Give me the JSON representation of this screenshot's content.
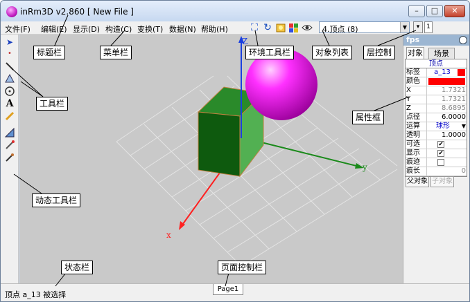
{
  "window": {
    "title": "inRm3D v2.860 [ New File ]",
    "buttons": [
      "–",
      "□",
      "✕"
    ]
  },
  "menubar": {
    "items": [
      "文件(F)",
      "编辑(E)",
      "显示(D)",
      "构造(C)",
      "变换(T)",
      "数据(N)",
      "帮助(H)"
    ]
  },
  "object_list": {
    "selected": "4.顶点 (8)"
  },
  "layer_control": {
    "value": "1"
  },
  "panel": {
    "fps": "fps",
    "tabs": [
      "对象",
      "场景"
    ],
    "header": "顶点",
    "rows": [
      {
        "name": "标签",
        "value": "a_13"
      },
      {
        "name": "颜色",
        "value": ""
      },
      {
        "name": "X",
        "value": "1.7321"
      },
      {
        "name": "Y",
        "value": "1.7321"
      },
      {
        "name": "Z",
        "value": "8.6895"
      },
      {
        "name": "点径",
        "value": "6.0000"
      },
      {
        "name": "运算",
        "value": "球形"
      },
      {
        "name": "透明",
        "value": "1.0000"
      },
      {
        "name": "可选",
        "value": "✔"
      },
      {
        "name": "显示",
        "value": "✔"
      },
      {
        "name": "痕迹",
        "value": ""
      },
      {
        "name": "痕长",
        "value": "0"
      }
    ],
    "buttons": [
      "父对象",
      "子对象"
    ]
  },
  "statusbar": {
    "text": "顶点 a_13 被选择",
    "page_tab": "Page1"
  },
  "axes": {
    "x": "x",
    "y": "y",
    "z": "Z"
  },
  "callouts": {
    "title": "标题栏",
    "menu": "菜单栏",
    "env_toolbar": "环境工具栏",
    "obj_list": "对象列表",
    "layer": "层控制",
    "toolbar": "工具栏",
    "props": "属性框",
    "dyn_toolbar": "动态工具栏",
    "status": "状态栏",
    "page_ctrl": "页面控制栏"
  },
  "colors": {
    "accent": "#e000e0",
    "cube": "#1e6e1e",
    "red": "#ff0000"
  }
}
